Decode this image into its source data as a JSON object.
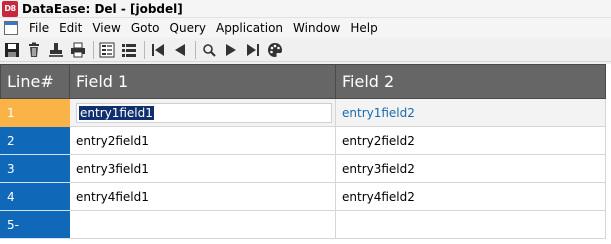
{
  "window": {
    "title": "DataEase: Del - [jobdel]",
    "icon_label": "D8"
  },
  "menu": {
    "items": [
      "File",
      "Edit",
      "View",
      "Goto",
      "Query",
      "Application",
      "Window",
      "Help"
    ]
  },
  "toolbar": {
    "icons": [
      "save-icon",
      "delete-icon",
      "stamp-icon",
      "print-icon",
      "form-view-icon",
      "table-view-icon",
      "first-record-icon",
      "previous-record-icon",
      "search-icon",
      "next-record-icon",
      "last-record-icon",
      "palette-icon"
    ]
  },
  "grid": {
    "headers": [
      "Line#",
      "Field 1",
      "Field 2"
    ],
    "rows": [
      {
        "line": "1",
        "field1": "entry1field1",
        "field2": "entry1field2"
      },
      {
        "line": "2",
        "field1": "entry2field1",
        "field2": "entry2field2"
      },
      {
        "line": "3",
        "field1": "entry3field1",
        "field2": "entry3field2"
      },
      {
        "line": "4",
        "field1": "entry4field1",
        "field2": "entry4field2"
      },
      {
        "line": "5-",
        "field1": "",
        "field2": ""
      }
    ],
    "current_row": 1,
    "colors": {
      "header_bg": "#666666",
      "line_bg": "#1068b8",
      "current_line_bg": "#f9b347",
      "selection_bg": "#0f2f6e"
    }
  }
}
